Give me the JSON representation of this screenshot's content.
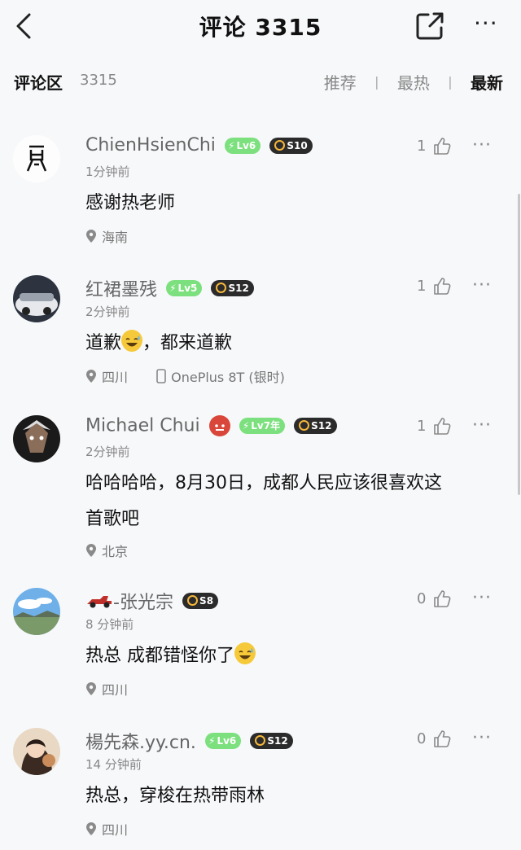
{
  "header": {
    "title": "评论 3315",
    "back_icon": "chevron-left-icon",
    "share_icon": "share-icon",
    "more_label": "···"
  },
  "subheader": {
    "section_label": "评论区",
    "count": "3315",
    "sort_tabs": [
      {
        "label": "推荐",
        "active": false
      },
      {
        "label": "最热",
        "active": false
      },
      {
        "label": "最新",
        "active": true
      }
    ],
    "separator": "|"
  },
  "comments": [
    {
      "username": "ChienHsienChi",
      "level": "Lv6",
      "season": "S10",
      "time": "1分钟前",
      "text": "感谢热老师",
      "location": "海南",
      "device": "",
      "likes": "1"
    },
    {
      "username": "红裙墨残",
      "level": "Lv5",
      "season": "S12",
      "time": "2分钟前",
      "text_before": "道歉",
      "text_after": "，都来道歉",
      "location": "四川",
      "device": "OnePlus 8T (银时)",
      "likes": "1"
    },
    {
      "username": "Michael Chui",
      "level": "Lv7年",
      "season": "S12",
      "time": "2分钟前",
      "text_line1": "哈哈哈哈，8月30日，成都人民应该很喜欢这",
      "text_line2": "首歌吧",
      "location": "北京",
      "device": "",
      "likes": "1"
    },
    {
      "username": "-张光宗",
      "level": "",
      "season": "S8",
      "time": "8 分钟前",
      "text": "热总 成都错怪你了",
      "location": "四川",
      "device": "",
      "likes": "0"
    },
    {
      "username": "楊先森.yy.cn.",
      "level": "Lv6",
      "season": "S12",
      "time": "14 分钟前",
      "text": "热总，穿梭在热带雨林",
      "location": "四川",
      "device": "",
      "likes": "0"
    }
  ],
  "colors": {
    "background": "#f7f8fa",
    "level_badge": "#7be07d",
    "season_badge": "#2b2b2b",
    "muted_text": "#888888"
  }
}
